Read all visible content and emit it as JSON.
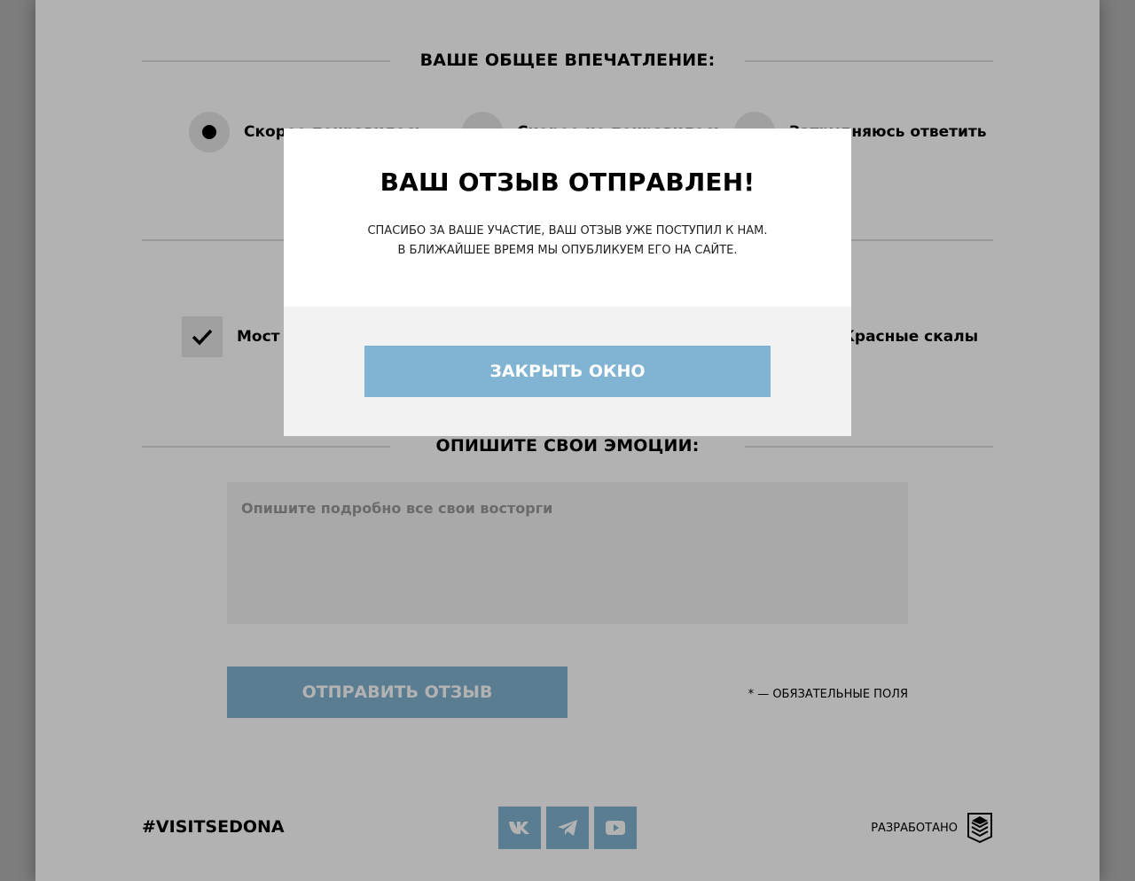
{
  "impression": {
    "heading": "Ваше общее впечатление:",
    "options": [
      {
        "label": "Скорее понравилось",
        "selected": true
      },
      {
        "label": "Скорее не понравилось",
        "selected": false
      },
      {
        "label": "Затрудняюсь ответить",
        "selected": false
      }
    ]
  },
  "places": {
    "options": [
      {
        "label": "Мост Дьявола",
        "checked": true
      },
      {
        "label": "Красные скалы",
        "checked": false
      }
    ]
  },
  "emotions": {
    "heading": "Опишите свои эмоции:",
    "placeholder": "Опишите подробно все свои восторги"
  },
  "form": {
    "submit_label": "Отправить отзыв",
    "required_note": "* — обязательные поля"
  },
  "footer": {
    "hashtag": "#VISITSEDONA",
    "social_icons": [
      "vk-icon",
      "telegram-icon",
      "youtube-icon"
    ],
    "developer_label": "Разработано",
    "developer_icon": "htmlacademy-logo-icon"
  },
  "modal": {
    "title": "Ваш отзыв отправлен!",
    "line1": "Спасибо за ваше участие, ваш отзыв уже поступил к нам.",
    "line2": "В ближайшее время мы опубликуем его на сайте.",
    "close_label": "Закрыть окно"
  },
  "colors": {
    "accent": "#81b3d2",
    "field_bg": "#f2f2f2",
    "control_bg": "#e5e5e5",
    "overlay": "rgba(0,0,0,0.3)"
  }
}
